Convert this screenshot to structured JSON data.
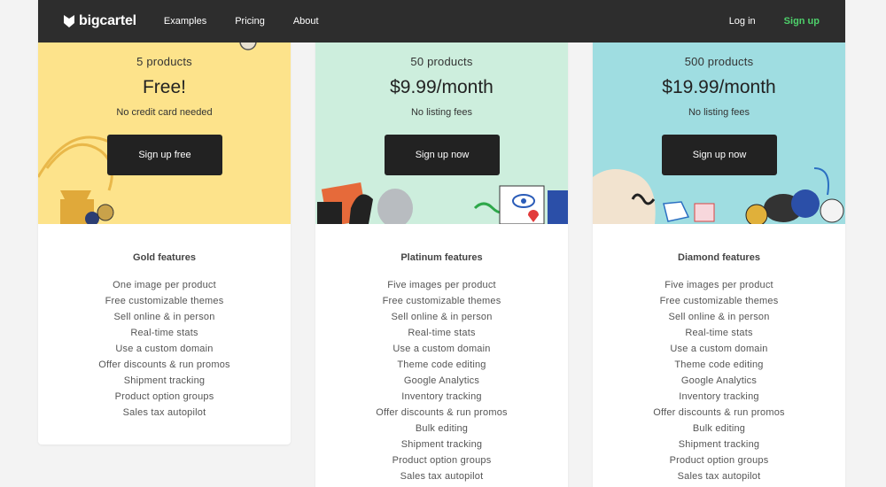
{
  "nav": {
    "logo_text": "bigcartel",
    "links": [
      "Examples",
      "Pricing",
      "About"
    ],
    "login_label": "Log in",
    "signup_label": "Sign up"
  },
  "plans": [
    {
      "count": "5 products",
      "price": "Free!",
      "note": "No credit card needed",
      "cta": "Sign up free",
      "features_title": "Gold features",
      "features": [
        "One image per product",
        "Free customizable themes",
        "Sell online & in person",
        "Real-time stats",
        "Use a custom domain",
        "Offer discounts & run promos",
        "Shipment tracking",
        "Product option groups",
        "Sales tax autopilot"
      ]
    },
    {
      "count": "50 products",
      "price": "$9.99/month",
      "note": "No listing fees",
      "cta": "Sign up now",
      "features_title": "Platinum features",
      "features": [
        "Five images per product",
        "Free customizable themes",
        "Sell online & in person",
        "Real-time stats",
        "Use a custom domain",
        "Theme code editing",
        "Google Analytics",
        "Inventory tracking",
        "Offer discounts & run promos",
        "Bulk editing",
        "Shipment tracking",
        "Product option groups",
        "Sales tax autopilot"
      ]
    },
    {
      "count": "500 products",
      "price": "$19.99/month",
      "note": "No listing fees",
      "cta": "Sign up now",
      "features_title": "Diamond features",
      "features": [
        "Five images per product",
        "Free customizable themes",
        "Sell online & in person",
        "Real-time stats",
        "Use a custom domain",
        "Theme code editing",
        "Google Analytics",
        "Inventory tracking",
        "Offer discounts & run promos",
        "Bulk editing",
        "Shipment tracking",
        "Product option groups",
        "Sales tax autopilot"
      ]
    }
  ],
  "colors": {
    "nav_bg": "#2d2d2d",
    "signup_accent": "#4ed16b",
    "gold_bg": "#fde38b",
    "platinum_bg": "#cdeedd",
    "diamond_bg": "#9fdde1",
    "button_bg": "#222222"
  }
}
